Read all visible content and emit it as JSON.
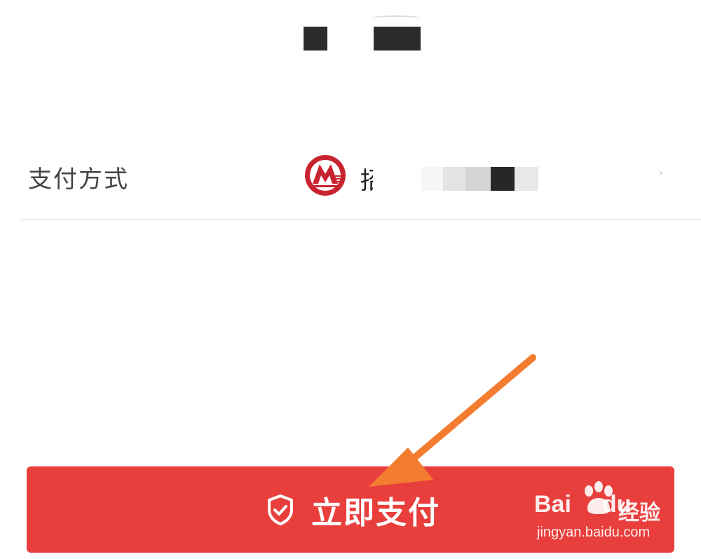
{
  "payment_method": {
    "label": "支付方式",
    "bank_name_partial": "招"
  },
  "pay_button": {
    "label": "立即支付",
    "color": "#e83f3d"
  },
  "bank_logo": {
    "color": "#c8242f"
  },
  "annotation": {
    "arrow_color": "#f47c30"
  },
  "watermark": {
    "brand": "Bai",
    "brand_suffix": "du",
    "cn": "经验",
    "url": "jingyan.baidu.com"
  }
}
